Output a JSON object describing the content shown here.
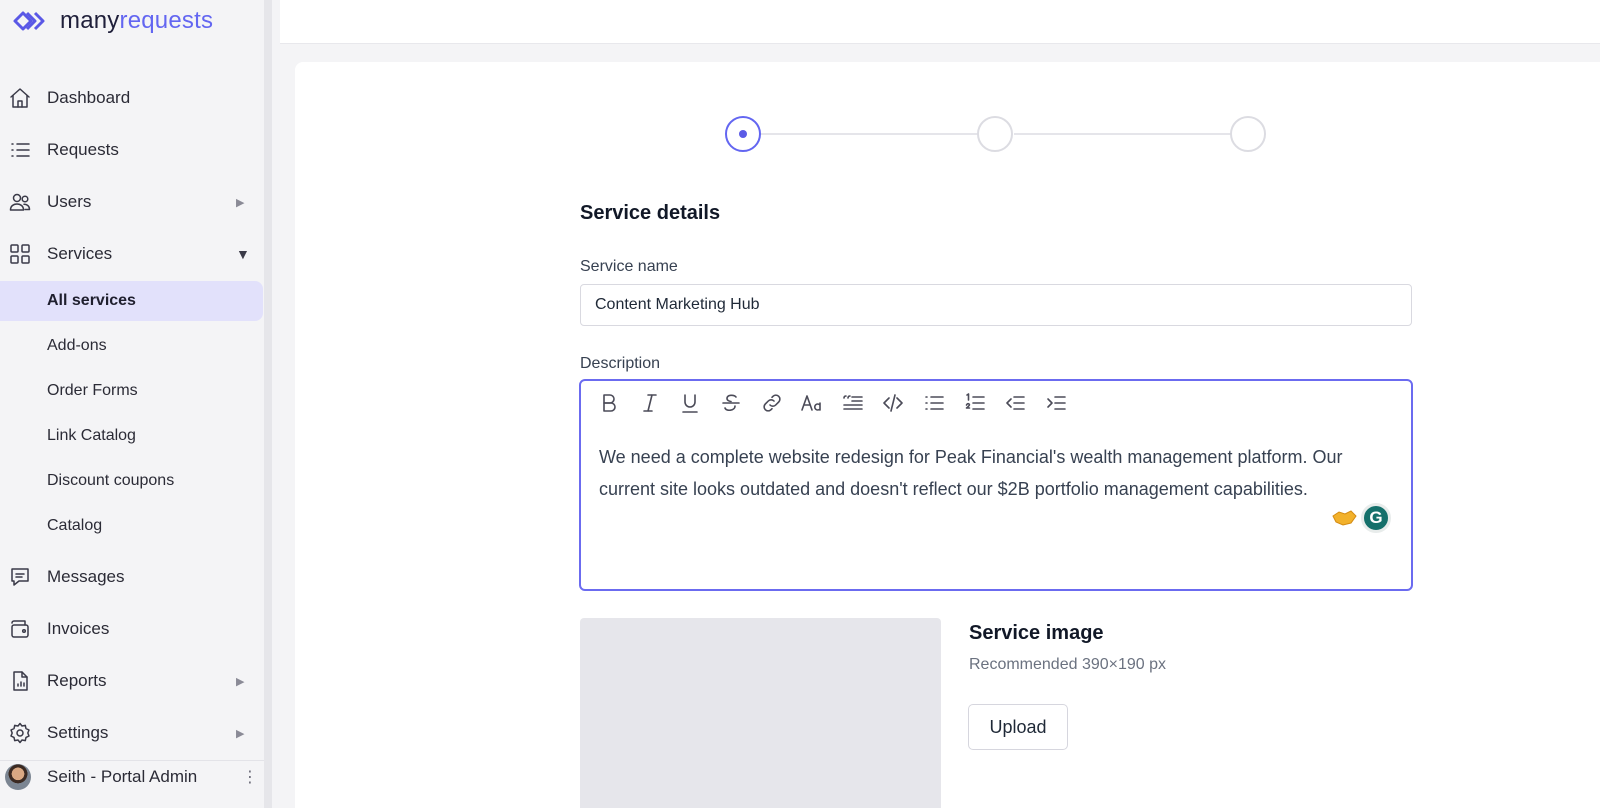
{
  "brand": {
    "name_part1": "many",
    "name_part2": "requests",
    "accent": "#6366f1"
  },
  "sidebar": {
    "items": [
      {
        "label": "Dashboard",
        "icon": "home-icon"
      },
      {
        "label": "Requests",
        "icon": "list-icon"
      },
      {
        "label": "Users",
        "icon": "users-icon",
        "caret": "▶"
      },
      {
        "label": "Services",
        "icon": "grid-icon",
        "caret": "▼"
      },
      {
        "label": "Messages",
        "icon": "message-icon"
      },
      {
        "label": "Invoices",
        "icon": "wallet-icon"
      },
      {
        "label": "Reports",
        "icon": "report-icon",
        "caret": "▶"
      },
      {
        "label": "Settings",
        "icon": "gear-icon",
        "caret": "▶"
      }
    ],
    "services_sub": [
      {
        "label": "All services",
        "active": true
      },
      {
        "label": "Add-ons"
      },
      {
        "label": "Order Forms"
      },
      {
        "label": "Link Catalog"
      },
      {
        "label": "Discount coupons"
      },
      {
        "label": "Catalog"
      }
    ],
    "user": {
      "name": "Seith - Portal Admin",
      "menu": "⋮"
    }
  },
  "stepper": {
    "steps": 3,
    "current": 1
  },
  "form": {
    "section_title": "Service details",
    "service_name_label": "Service name",
    "service_name_value": "Content Marketing Hub",
    "description_label": "Description",
    "description_text": "We need a complete website redesign for Peak Financial's wealth management platform. Our current site looks outdated and doesn't reflect our $2B portfolio management capabilities.",
    "toolbar": [
      "bold-icon",
      "italic-icon",
      "underline-icon",
      "strikethrough-icon",
      "link-icon",
      "font-size-icon",
      "blockquote-icon",
      "code-icon",
      "bullet-list-icon",
      "numbered-list-icon",
      "outdent-icon",
      "indent-icon"
    ],
    "grammarly_glyph": "G"
  },
  "service_image": {
    "title": "Service image",
    "hint": "Recommended 390×190 px",
    "upload_label": "Upload"
  }
}
